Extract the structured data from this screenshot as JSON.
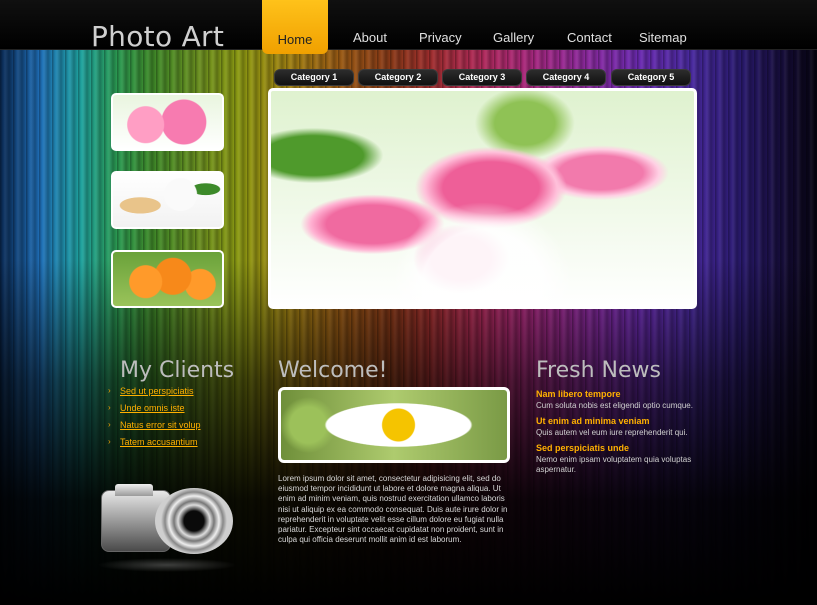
{
  "header": {
    "logo": "Photo Art",
    "nav": [
      {
        "label": "Home",
        "active": true
      },
      {
        "label": "About",
        "active": false
      },
      {
        "label": "Privacy",
        "active": false
      },
      {
        "label": "Gallery",
        "active": false
      },
      {
        "label": "Contact",
        "active": false
      },
      {
        "label": "Sitemap",
        "active": false
      }
    ],
    "accent": "#f0a000"
  },
  "categories": [
    "Category 1",
    "Category 2",
    "Category 3",
    "Category 4",
    "Category 5"
  ],
  "clients": {
    "title": "My Clients",
    "links": [
      "Sed ut perspiciatis",
      "Unde omnis iste",
      "Natus error sit volup",
      "Tatem accusantium"
    ]
  },
  "welcome": {
    "title": "Welcome!",
    "text": "Lorem ipsum dolor sit amet, consectetur adipisicing elit, sed do eiusmod tempor incididunt ut labore et dolore magna aliqua. Ut enim ad minim veniam, quis nostrud exercitation ullamco laboris nisi ut aliquip ex ea commodo consequat. Duis aute irure dolor in reprehenderit in voluptate velit esse cillum dolore eu fugiat nulla pariatur. Excepteur sint occaecat cupidatat non proident, sunt in culpa qui officia deserunt mollit anim id est laborum."
  },
  "news": {
    "title": "Fresh News",
    "items": [
      {
        "title": "Nam libero tempore",
        "body": "Cum soluta nobis est eligendi optio cumque."
      },
      {
        "title": "Ut enim ad minima veniam",
        "body": "Quis autem vel eum iure reprehenderit qui."
      },
      {
        "title": "Sed perspiciatis unde",
        "body": "Nemo enim ipsam voluptatem quia voluptas aspernatur."
      }
    ]
  }
}
